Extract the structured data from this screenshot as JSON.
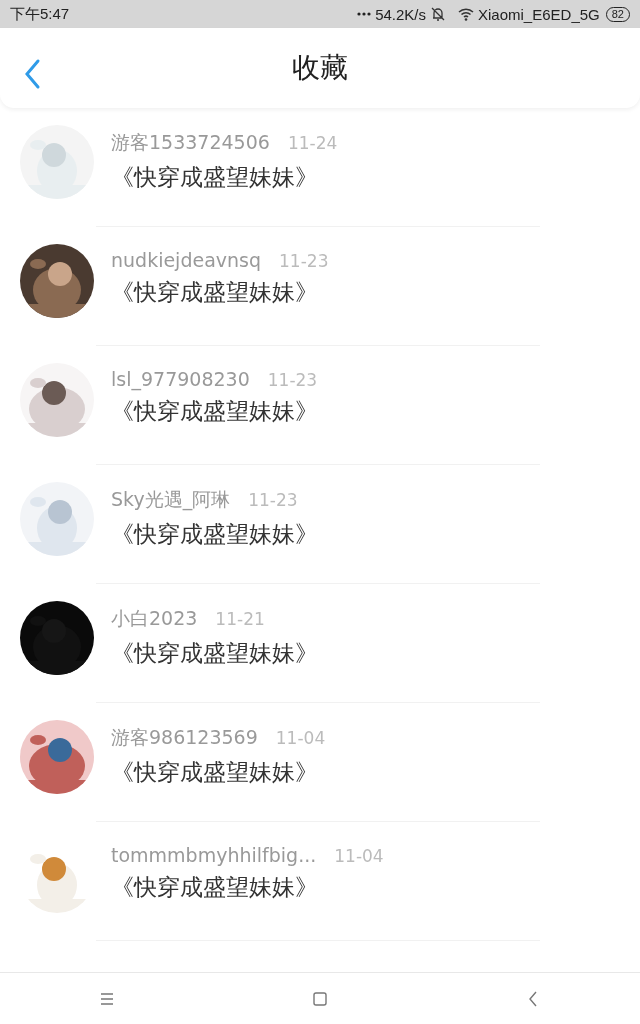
{
  "status_bar": {
    "time": "下午5:47",
    "network_speed": "54.2K/s",
    "wifi_name": "Xiaomi_E6ED_5G",
    "battery": "82"
  },
  "header": {
    "title": "收藏"
  },
  "favorites": [
    {
      "user": "游客1533724506",
      "date": "11-24",
      "book": "《快穿成盛望妹妹》"
    },
    {
      "user": "nudkiejdeavnsq",
      "date": "11-23",
      "book": "《快穿成盛望妹妹》"
    },
    {
      "user": "lsl_977908230",
      "date": "11-23",
      "book": "《快穿成盛望妹妹》"
    },
    {
      "user": "Sky光遇_阿琳",
      "date": "11-23",
      "book": "《快穿成盛望妹妹》"
    },
    {
      "user": "小白2023",
      "date": "11-21",
      "book": "《快穿成盛望妹妹》"
    },
    {
      "user": "游客986123569",
      "date": "11-04",
      "book": "《快穿成盛望妹妹》"
    },
    {
      "user": "tommmbmyhhilfbig...",
      "date": "11-04",
      "book": "《快穿成盛望妹妹》"
    }
  ]
}
